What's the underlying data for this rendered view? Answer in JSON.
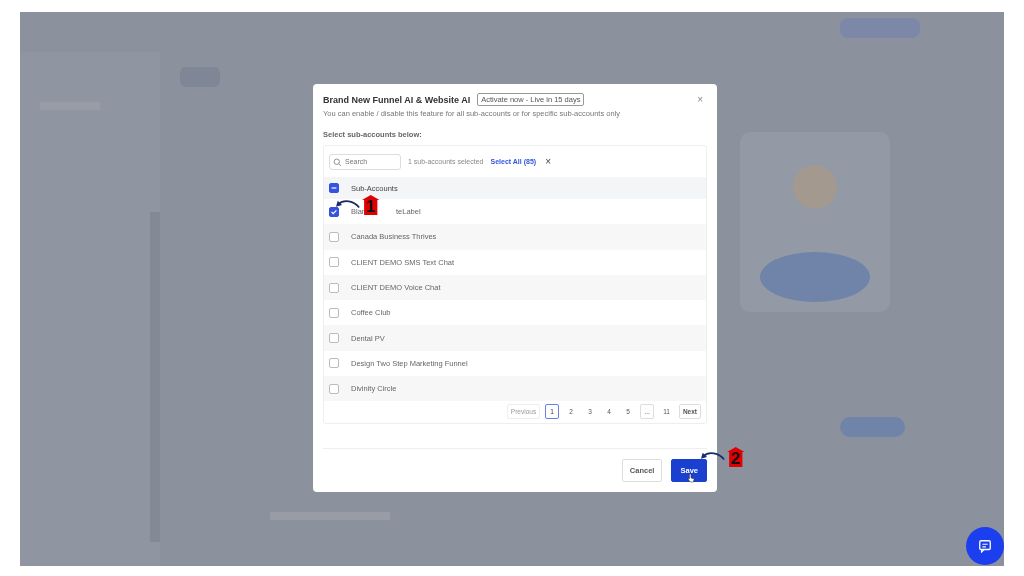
{
  "dialog": {
    "title": "Brand New Funnel AI & Website AI",
    "badge": "Activate now - Live in 15 days",
    "description": "You can enable / disable this feature for all sub-accounts or for specific sub-accounts only",
    "section_label": "Select sub-accounts below:",
    "close": "×"
  },
  "toolbar": {
    "search_placeholder": "Search",
    "selection_count": "1 sub-accounts selected",
    "select_all": "Select All (85)",
    "clear": "×"
  },
  "table": {
    "header": {
      "label": "Sub-Accounts",
      "indeterminate": true
    },
    "rows": [
      {
        "label": "Blan",
        "label_end": "teLabel",
        "checked": true
      },
      {
        "label": "Canada Business Thrives",
        "checked": false
      },
      {
        "label": "CLIENT DEMO SMS Text Chat",
        "checked": false
      },
      {
        "label": "CLIENT DEMO Voice Chat",
        "checked": false
      },
      {
        "label": "Coffee Club",
        "checked": false
      },
      {
        "label": "Dental PV",
        "checked": false
      },
      {
        "label": "Design Two Step Marketing Funnel",
        "checked": false
      },
      {
        "label": "Divinity Circle",
        "checked": false
      }
    ]
  },
  "pagination": [
    {
      "label": "Previous",
      "kind": "nav",
      "disabled": true,
      "selected": false
    },
    {
      "label": "1",
      "kind": "page",
      "disabled": false,
      "selected": true
    },
    {
      "label": "2",
      "kind": "page",
      "disabled": false,
      "selected": false
    },
    {
      "label": "3",
      "kind": "page",
      "disabled": false,
      "selected": false
    },
    {
      "label": "4",
      "kind": "page",
      "disabled": false,
      "selected": false
    },
    {
      "label": "5",
      "kind": "page",
      "disabled": false,
      "selected": false
    },
    {
      "label": "...",
      "kind": "ellipsis",
      "disabled": false,
      "selected": false
    },
    {
      "label": "11",
      "kind": "page",
      "disabled": false,
      "selected": false
    },
    {
      "label": "Next",
      "kind": "nav",
      "disabled": false,
      "selected": false
    }
  ],
  "buttons": [
    {
      "label": "Cancel",
      "kind": "secondary"
    },
    {
      "label": "Save",
      "kind": "primary"
    }
  ],
  "callouts": [
    {
      "number": "1"
    },
    {
      "number": "2"
    }
  ]
}
